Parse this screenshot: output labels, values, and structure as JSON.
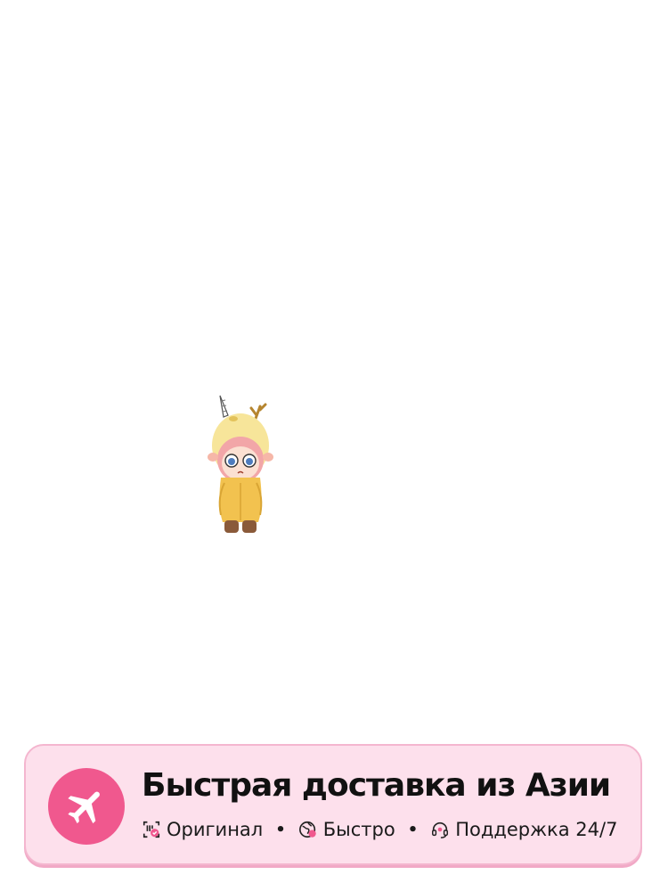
{
  "banner": {
    "title": "Быстрая доставка из Азии",
    "features": [
      {
        "label": "Оригинал",
        "icon": "original-badge-icon"
      },
      {
        "label": "Быстро",
        "icon": "globe-icon"
      },
      {
        "label": "Поддержка 24/7",
        "icon": "headset-icon"
      }
    ],
    "separator": "•",
    "badge_icon": "airplane-icon",
    "colors": {
      "background": "#fde0ec",
      "border": "#f4b6cf",
      "badge": "#f0588e"
    }
  },
  "figure": {
    "icon": "toy-figure-illustration"
  }
}
